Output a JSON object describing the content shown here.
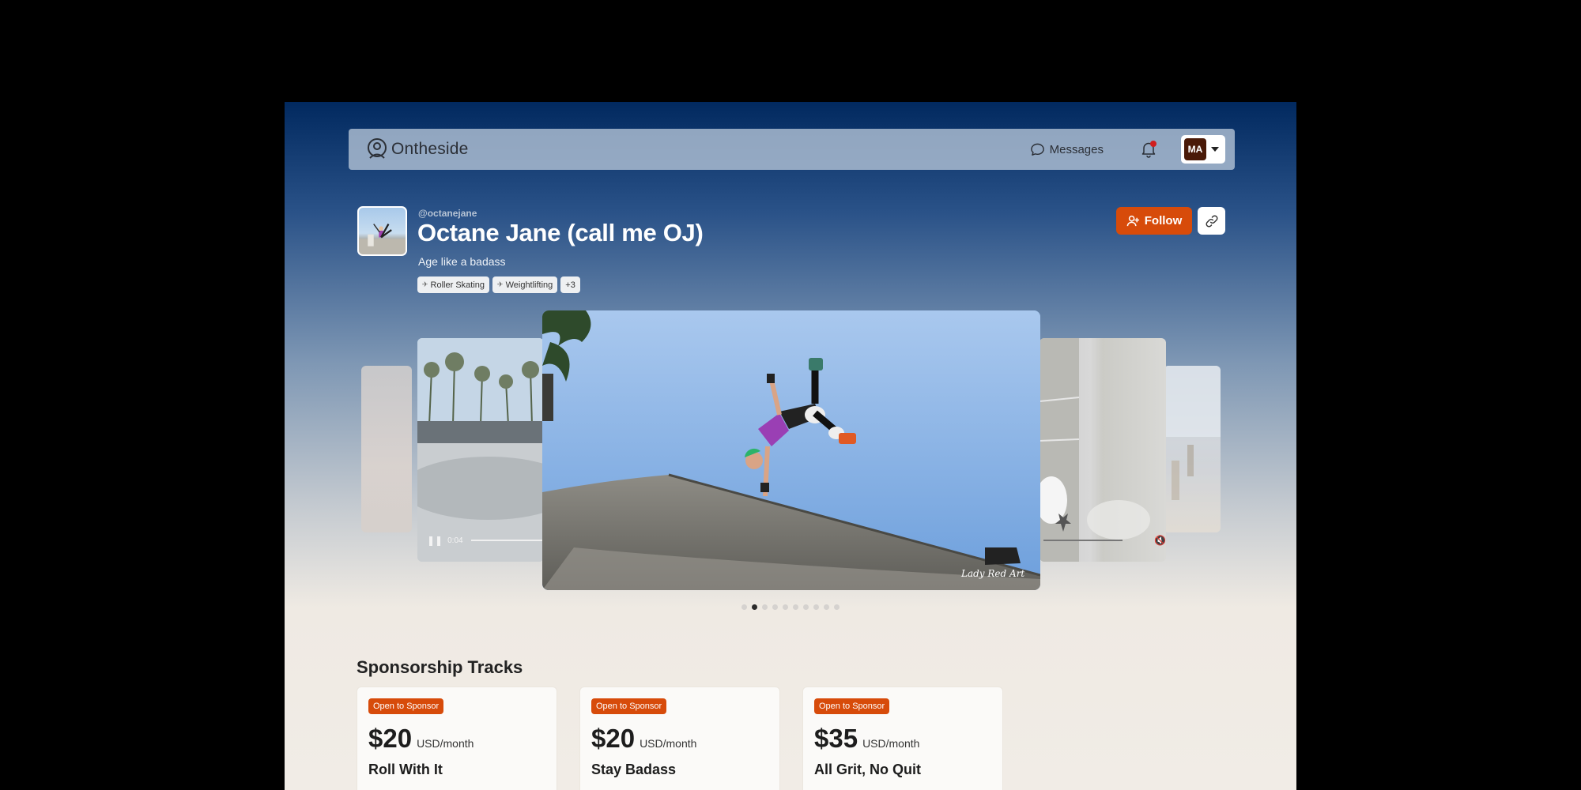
{
  "brand": {
    "name": "Ontheside"
  },
  "nav": {
    "messages_label": "Messages",
    "avatar_initials": "MA",
    "notification_dot_color": "#d01e1e"
  },
  "profile": {
    "handle": "@octanejane",
    "name": "Octane Jane (call me OJ)",
    "tagline": "Age like a badass",
    "tags": [
      {
        "label": "Roller Skating",
        "icon": "wing-icon"
      },
      {
        "label": "Weightlifting",
        "icon": "wing-icon"
      },
      {
        "label": "+3"
      }
    ],
    "follow_label": "Follow"
  },
  "carousel": {
    "video_time_left": "0:04",
    "slide_count": 10,
    "active_index": 1,
    "watermark": "Lady Red Art"
  },
  "sponsorship": {
    "title": "Sponsorship Tracks",
    "tracks": [
      {
        "badge": "Open to Sponsor",
        "price": "$20",
        "period": "USD/month",
        "name": "Roll With It"
      },
      {
        "badge": "Open to Sponsor",
        "price": "$20",
        "period": "USD/month",
        "name": "Stay Badass"
      },
      {
        "badge": "Open to Sponsor",
        "price": "$35",
        "period": "USD/month",
        "name": "All Grit, No Quit"
      }
    ]
  },
  "colors": {
    "accent": "#d74b0a",
    "nav_bg": "#b7c6d8",
    "avatar_bg": "#4a1a08"
  }
}
